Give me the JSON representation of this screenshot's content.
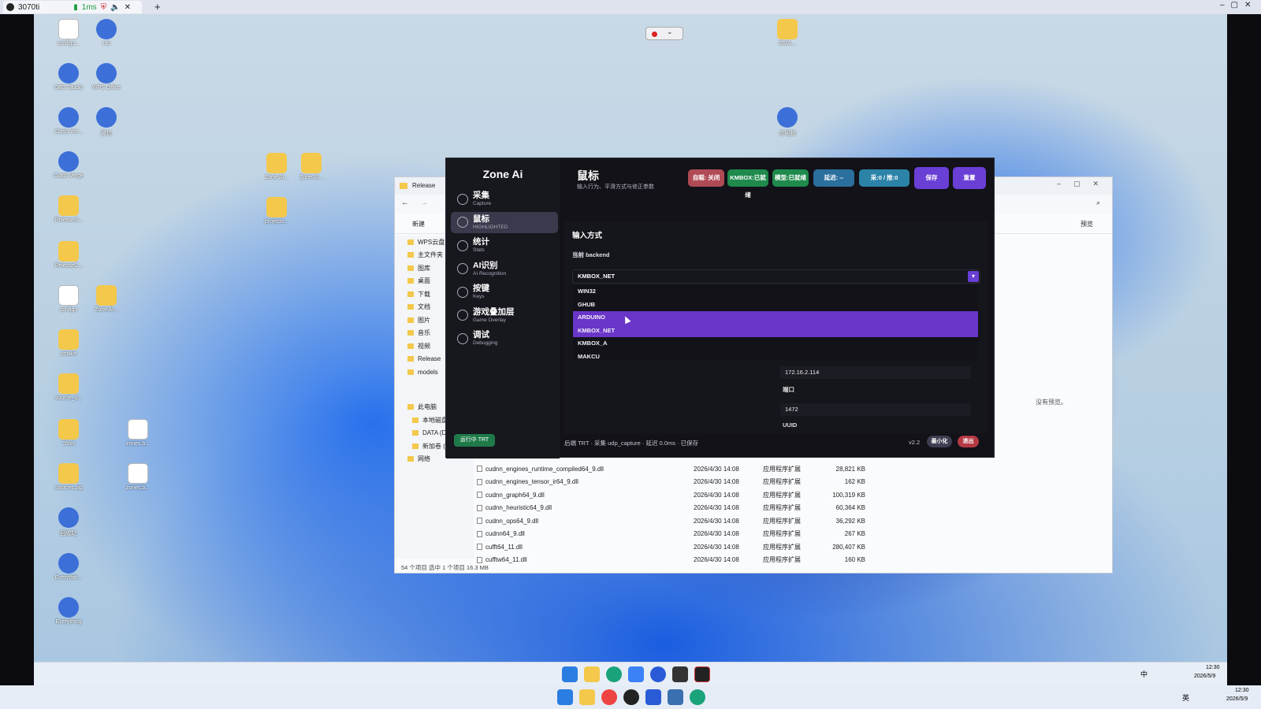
{
  "host": {
    "tab_title": "3070ti",
    "ping": "1ms",
    "new_tab": "+",
    "close_tab": "✕"
  },
  "desktop_icons": [
    {
      "label": "config.t...",
      "kind": "file"
    },
    {
      "label": "t.to",
      "kind": "app"
    },
    {
      "label": "OBS Studio",
      "kind": "app"
    },
    {
      "label": "WPS Office",
      "kind": "app"
    },
    {
      "label": "Clash.Ver...",
      "kind": "app"
    },
    {
      "label": "微信",
      "kind": "app"
    },
    {
      "label": "Clash Verge",
      "kind": "app"
    },
    {
      "label": "Release3...",
      "kind": "folder"
    },
    {
      "label": "Release2...",
      "kind": "folder"
    },
    {
      "label": "config.t",
      "kind": "file"
    },
    {
      "label": "Zone AI...",
      "kind": "folder"
    },
    {
      "label": "cmake",
      "kind": "folder"
    },
    {
      "label": "source_0...",
      "kind": "folder"
    },
    {
      "label": "Tools",
      "kind": "folder"
    },
    {
      "label": "zones.b...",
      "kind": "file"
    },
    {
      "label": "sources.zip",
      "kind": "folder"
    },
    {
      "label": "zones.b...",
      "kind": "file"
    },
    {
      "label": "回收站",
      "kind": "app"
    },
    {
      "label": "Everythin...",
      "kind": "app"
    },
    {
      "label": "Everything",
      "kind": "app"
    },
    {
      "label": "Zone AI...",
      "kind": "folder"
    },
    {
      "label": "Zone AI...",
      "kind": "folder"
    },
    {
      "label": "projects...",
      "kind": "folder"
    },
    {
      "label": "DMA...",
      "kind": "folder"
    },
    {
      "label": "此电脑",
      "kind": "app"
    }
  ],
  "explorer": {
    "tab": "Release",
    "new_btn": "新建",
    "preview_btn": "预览",
    "no_preview": "没有预览。",
    "nav": [
      "WPS云盘",
      "主文件夹",
      "图库",
      "桌面",
      "下载",
      "文档",
      "图片",
      "音乐",
      "视频",
      "Release",
      "models",
      "此电脑",
      "本地磁盘",
      "DATA (D:)",
      "新加卷 (E:)",
      "网络"
    ],
    "files": [
      {
        "name": "cudnn_engines_runtime_compiled64_9.dll",
        "date": "2026/4/30 14:08",
        "type": "应用程序扩展",
        "size": "28,821 KB"
      },
      {
        "name": "cudnn_engines_tensor_ir64_9.dll",
        "date": "2026/4/30 14:08",
        "type": "应用程序扩展",
        "size": "162 KB"
      },
      {
        "name": "cudnn_graph64_9.dll",
        "date": "2026/4/30 14:08",
        "type": "应用程序扩展",
        "size": "100,319 KB"
      },
      {
        "name": "cudnn_heuristic64_9.dll",
        "date": "2026/4/30 14:08",
        "type": "应用程序扩展",
        "size": "60,364 KB"
      },
      {
        "name": "cudnn_ops64_9.dll",
        "date": "2026/4/30 14:08",
        "type": "应用程序扩展",
        "size": "36,292 KB"
      },
      {
        "name": "cudnn64_9.dll",
        "date": "2026/4/30 14:08",
        "type": "应用程序扩展",
        "size": "267 KB"
      },
      {
        "name": "cufft64_11.dll",
        "date": "2026/4/30 14:08",
        "type": "应用程序扩展",
        "size": "280,407 KB"
      },
      {
        "name": "cufftw64_11.dll",
        "date": "2026/4/30 14:08",
        "type": "应用程序扩展",
        "size": "160 KB"
      }
    ],
    "status": "54 个项目    选中 1 个项目  16.3 MB"
  },
  "app": {
    "brand": "Zone Ai",
    "nav": [
      {
        "label": "采集",
        "sub": "Capture",
        "icon": "camera-icon"
      },
      {
        "label": "鼠标",
        "sub": "HIGHLIGHTED",
        "icon": "mouse-icon"
      },
      {
        "label": "统计",
        "sub": "Stats",
        "icon": "chart-icon"
      },
      {
        "label": "AI识别",
        "sub": "AI Recognition",
        "icon": "ai-icon"
      },
      {
        "label": "按键",
        "sub": "Keys",
        "icon": "keyboard-icon"
      },
      {
        "label": "游戏叠加层",
        "sub": "Game Overlay",
        "icon": "crosshair-icon"
      },
      {
        "label": "调试",
        "sub": "Debugging",
        "icon": "monitor-icon"
      }
    ],
    "running": "运行中 TRT",
    "page_title": "鼠标",
    "page_subtitle": "输入行为、平滑方式与修正参数",
    "badges": [
      {
        "label": "自瞄: 关闭",
        "color": "#b04a55"
      },
      {
        "label": "KMBOX:已就绪",
        "color": "#1f8a4c"
      },
      {
        "label": "模型:已就绪",
        "color": "#1f8a4c"
      },
      {
        "label": "延迟: --",
        "color": "#2b6f9e"
      },
      {
        "label": "采:0 / 推:0",
        "color": "#2b83a8"
      },
      {
        "label": "保存",
        "color": "#6a3fd6"
      },
      {
        "label": "重置",
        "color": "#6a3fd6"
      }
    ],
    "section_title": "输入方式",
    "backend_label": "当前 backend",
    "backend_value": "KMBOX_NET",
    "options": [
      "WIN32",
      "GHUB",
      "ARDUINO",
      "KMBOX_NET",
      "KMBOX_A",
      "MAKCU"
    ],
    "selected_options": [
      "ARDUINO",
      "KMBOX_NET"
    ],
    "ip_value": "172.16.2.114",
    "port_label": "端口",
    "port_value": "1472",
    "uuid_label": "UUID",
    "status_bar": "后端 TRT  ·  采集 udp_capture  ·  延迟 0.0ms  ·  已保存",
    "version": "v2.2",
    "minimize": "最小化",
    "exit": "退出"
  },
  "tray": {
    "lang": "中",
    "lang2": "英",
    "time": "12:30",
    "date": "2026/5/9"
  }
}
